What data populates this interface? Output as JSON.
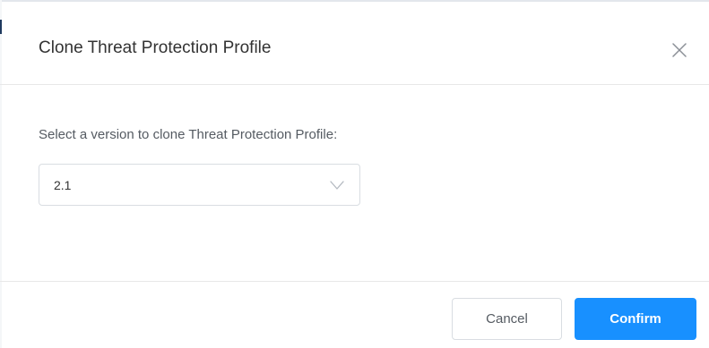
{
  "dialog": {
    "title": "Clone Threat Protection Profile",
    "close_icon": "close-icon"
  },
  "body": {
    "prompt": "Select a version to clone Threat Protection Profile:",
    "version_select": {
      "selected_value": "2.1",
      "icon": "chevron-down-icon"
    }
  },
  "footer": {
    "cancel_label": "Cancel",
    "confirm_label": "Confirm"
  },
  "colors": {
    "accent": "#1890ff",
    "title_text": "#333333",
    "body_text": "#555b62",
    "border": "#d9dde2",
    "divider": "#e8e8e8"
  }
}
